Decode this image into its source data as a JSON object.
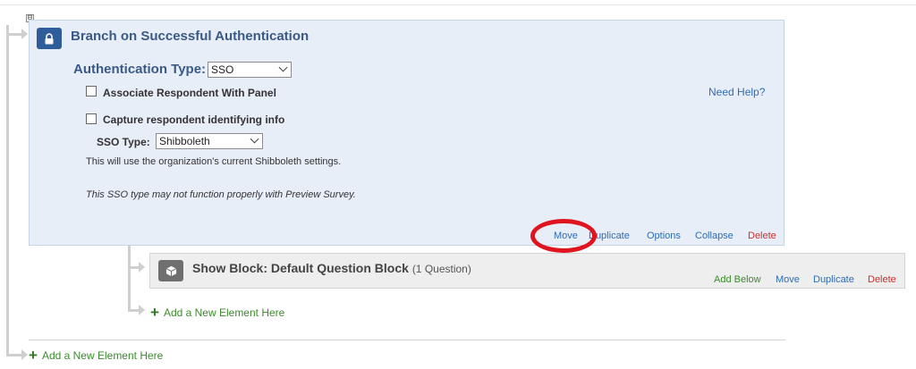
{
  "branch": {
    "collapse_symbol": "⊟",
    "title": "Branch on Successful Authentication",
    "auth_type_label": "Authentication Type:",
    "auth_type_value": "SSO",
    "associate_label": "Associate Respondent With Panel",
    "capture_label": "Capture respondent identifying info",
    "help_link": "Need Help?",
    "sso_type_label": "SSO Type:",
    "sso_type_value": "Shibboleth",
    "info_text": "This will use the organization's current Shibboleth settings.",
    "warning_text": "This SSO type may not function properly with Preview Survey.",
    "actions": {
      "move": "Move",
      "duplicate": "Duplicate",
      "options": "Options",
      "collapse": "Collapse",
      "delete": "Delete"
    }
  },
  "show_block": {
    "title": "Show Block: Default Question Block",
    "count": "(1 Question)",
    "actions": {
      "add_below": "Add Below",
      "move": "Move",
      "duplicate": "Duplicate",
      "delete": "Delete"
    }
  },
  "add_element_inner": "Add a New Element Here",
  "add_element_outer": "Add a New Element Here",
  "icons": {
    "branch": "lock-icon",
    "block": "cube-icon",
    "add": "plus-icon"
  },
  "colors": {
    "accent_title": "#3a5a85",
    "branch_background": "#e8eef8",
    "link_blue": "#2e6db3",
    "delete_red": "#c9302c",
    "add_green": "#3c8a2e",
    "highlight_red": "#e0141e"
  }
}
